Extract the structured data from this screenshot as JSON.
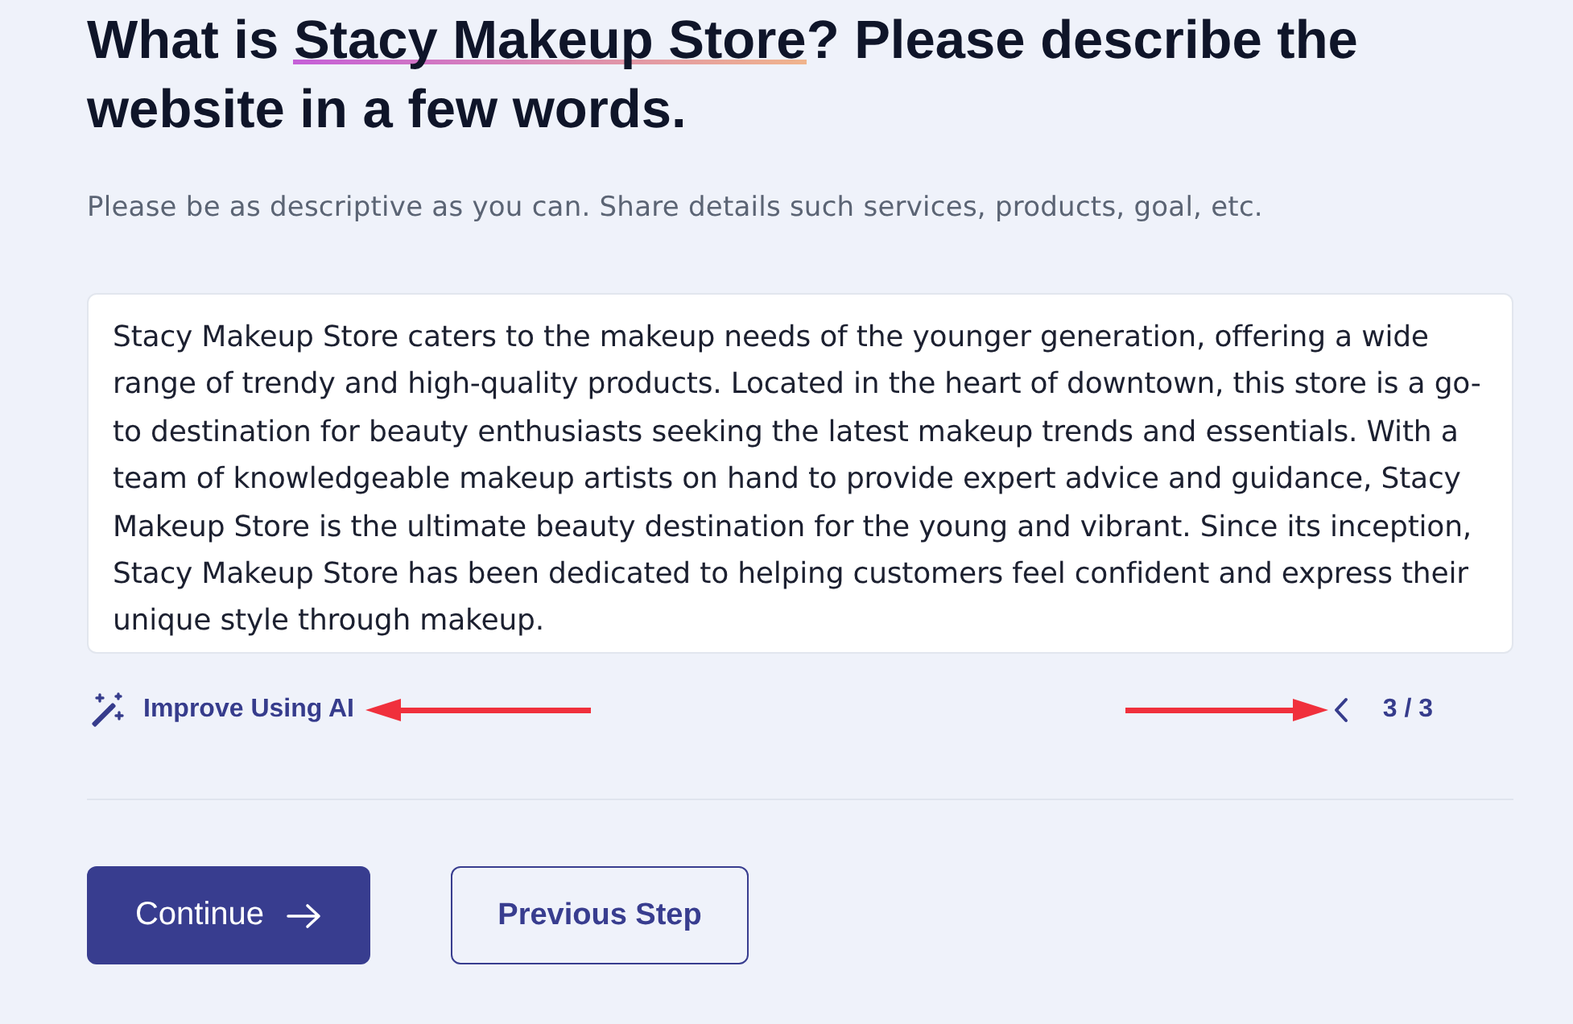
{
  "heading": {
    "before": "What is ",
    "highlight": "Stacy Makeup Store",
    "after": "? Please describe the website in a few words."
  },
  "hint": "Please be as descriptive as you can. Share details such services, products, goal, etc.",
  "description": {
    "value": "Stacy Makeup Store caters to the makeup needs of the younger generation, offering a wide range of trendy and high-quality products. Located in the heart of downtown, this store is a go-to destination for beauty enthusiasts seeking the latest makeup trends and essentials. With a team of knowledgeable makeup artists on hand to provide expert advice and guidance, Stacy Makeup Store is the ultimate beauty destination for the young and vibrant. Since its inception, Stacy Makeup Store has been dedicated to helping customers feel confident and express their unique style through makeup."
  },
  "improve_link": "Improve Using AI",
  "pager": {
    "text": "3 / 3"
  },
  "buttons": [
    {
      "label": "Continue",
      "kind": "primary"
    },
    {
      "label": "Previous Step",
      "kind": "secondary"
    }
  ]
}
